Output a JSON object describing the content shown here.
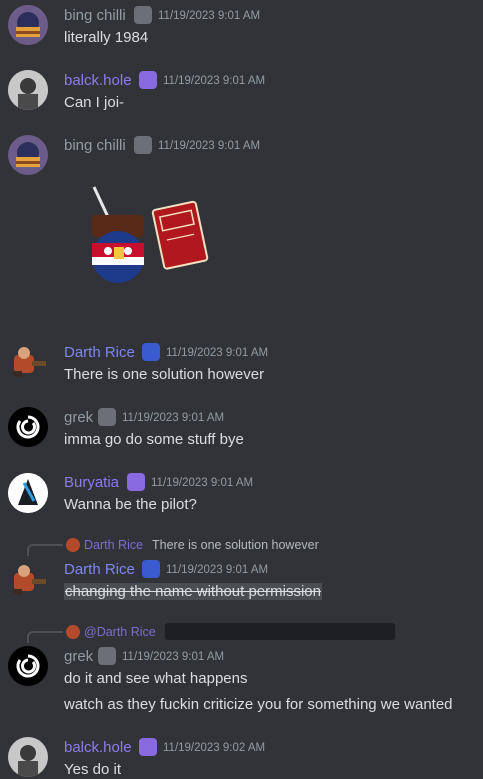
{
  "colors": {
    "background": "#313338",
    "gray_name": "#949ba4",
    "purple_name": "#8c7cf0",
    "blue_name": "#7f86f5",
    "message_text": "#dbdee1",
    "timestamp": "#949ba4"
  },
  "messages": [
    {
      "author": "bing chilli",
      "timestamp": "11/19/2023 9:01 AM",
      "lines": [
        "literally 1984"
      ]
    },
    {
      "author": "balck.hole",
      "timestamp": "11/19/2023 9:01 AM",
      "lines": [
        "Can I joi-"
      ]
    },
    {
      "author": "bing chilli",
      "timestamp": "11/19/2023 9:01 AM",
      "lines": [],
      "sticker": "countryball-1984-book-sticker"
    },
    {
      "author": "Darth Rice",
      "timestamp": "11/19/2023 9:01 AM",
      "lines": [
        "There is one solution however"
      ]
    },
    {
      "author": "grek",
      "timestamp": "11/19/2023 9:01 AM",
      "lines": [
        "imma go do some stuff bye"
      ]
    },
    {
      "author": "Buryatia",
      "timestamp": "11/19/2023 9:01 AM",
      "lines": [
        "Wanna be the pilot?"
      ]
    },
    {
      "author": "Darth Rice",
      "timestamp": "11/19/2023 9:01 AM",
      "reply": {
        "author": "Darth Rice",
        "text": "There is one solution however"
      },
      "lines": [
        "changing the name without permission"
      ]
    },
    {
      "author": "grek",
      "timestamp": "11/19/2023 9:01 AM",
      "reply": {
        "author": "@Darth Rice",
        "text": ""
      },
      "lines": [
        "do it and see what happens",
        "watch as they fuckin criticize you for something we wanted"
      ]
    },
    {
      "author": "balck.hole",
      "timestamp": "11/19/2023 9:02 AM",
      "lines": [
        "Yes do it"
      ]
    }
  ]
}
